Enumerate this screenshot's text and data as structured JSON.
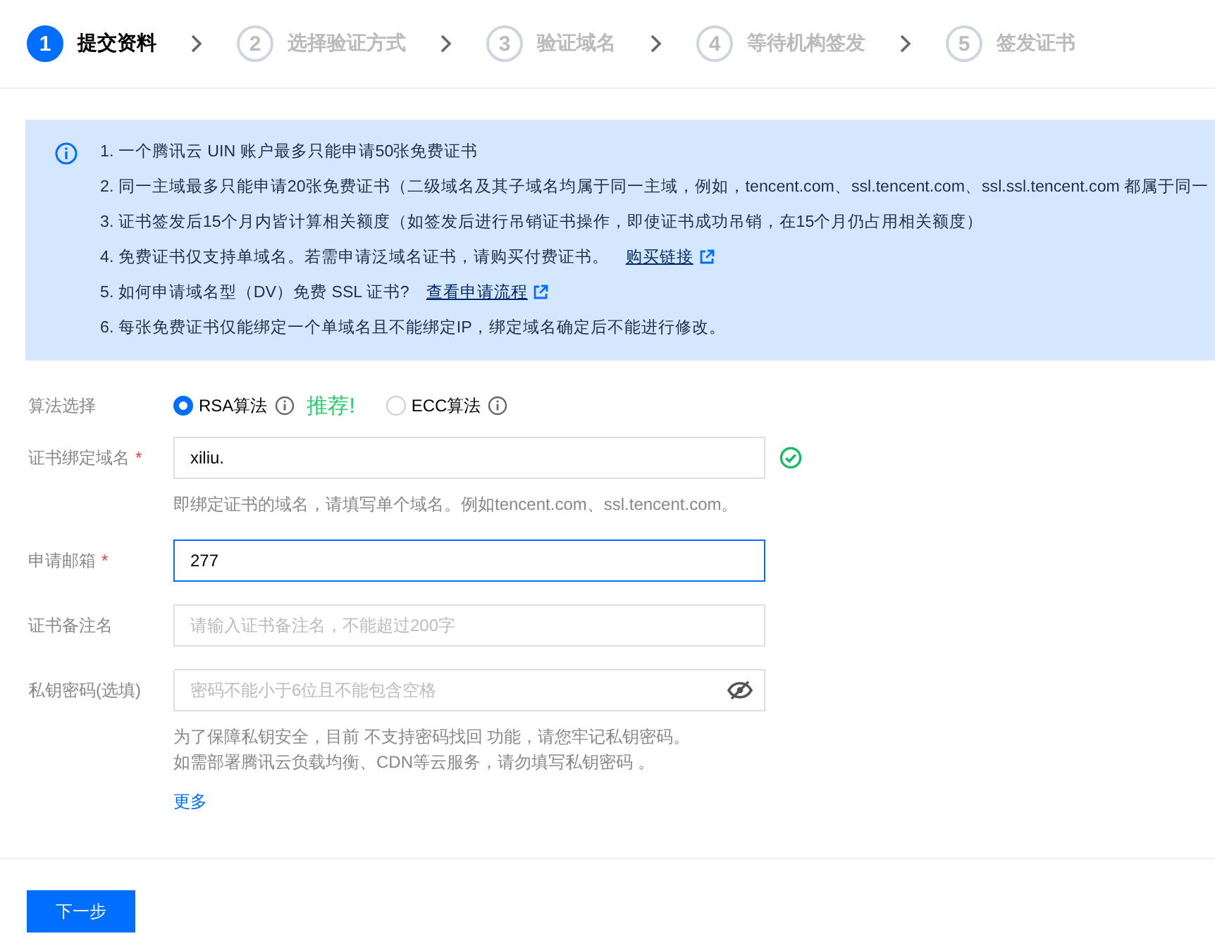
{
  "steps": [
    {
      "number": "1",
      "label": "提交资料",
      "selected": true
    },
    {
      "number": "2",
      "label": "选择验证方式",
      "selected": false
    },
    {
      "number": "3",
      "label": "验证域名",
      "selected": false
    },
    {
      "number": "4",
      "label": "等待机构签发",
      "selected": false
    },
    {
      "number": "5",
      "label": "签发证书",
      "selected": false
    }
  ],
  "notices": [
    {
      "text": "1. 一个腾讯云 UIN 账户最多只能申请50张免费证书"
    },
    {
      "text": "2. 同一主域最多只能申请20张免费证书（二级域名及其子域名均属于同一主域，例如，tencent.com、ssl.tencent.com、ssl.ssl.tencent.com 都属于同一"
    },
    {
      "text": "3. 证书签发后15个月内皆计算相关额度（如签发后进行吊销证书操作，即使证书成功吊销，在15个月仍占用相关额度）"
    },
    {
      "text": "4. 免费证书仅支持单域名。若需申请泛域名证书，请购买付费证书。",
      "link": "购买链接"
    },
    {
      "text": "5. 如何申请域名型（DV）免费 SSL 证书?",
      "link": "查看申请流程"
    },
    {
      "text": "6. 每张免费证书仅能绑定一个单域名且不能绑定IP，绑定域名确定后不能进行修改。"
    }
  ],
  "algorithm": {
    "label": "算法选择",
    "options": [
      {
        "label": "RSA算法",
        "selected": true,
        "tag": "推荐!"
      },
      {
        "label": "ECC算法",
        "selected": false
      }
    ]
  },
  "fields": [
    {
      "kind": "domain",
      "label": "证书绑定域名",
      "required_mark": "*",
      "value": "xiliu.",
      "valid": true,
      "focused": false,
      "help": [
        "即绑定证书的域名，请填写单个域名。例如tencent.com、ssl.tencent.com。"
      ]
    },
    {
      "kind": "email",
      "label": "申请邮箱",
      "required_mark": "*",
      "value": "277",
      "focused": true
    },
    {
      "kind": "remark",
      "label": "证书备注名",
      "placeholder": "请输入证书备注名，不能超过200字",
      "focused": false
    },
    {
      "kind": "password",
      "label": "私钥密码(选填)",
      "placeholder": "密码不能小于6位且不能包含空格",
      "focused": false,
      "help": [
        "为了保障私钥安全，目前 不支持密码找回 功能，请您牢记私钥密码。",
        "如需部署腾讯云负载均衡、CDN等云服务，请勿填写私钥密码 。"
      ],
      "more": "更多"
    }
  ],
  "next_button": "下一步"
}
